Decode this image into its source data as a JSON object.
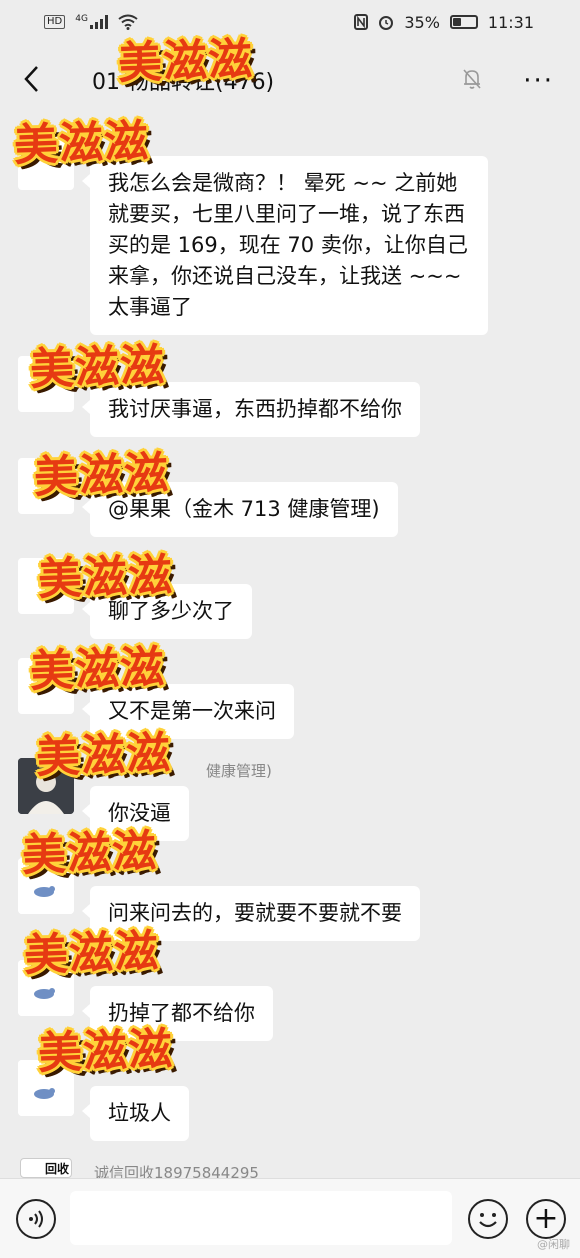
{
  "status_bar": {
    "hd": "HD",
    "network": "4G",
    "battery": "35%",
    "battery_level": 0.35,
    "time": "11:31"
  },
  "header": {
    "title": "01              物品转让(476)",
    "back_icon": "chevron-left-icon",
    "mute_icon": "bell-off-icon",
    "more_icon": "ellipsis-icon",
    "more_label": "···"
  },
  "messages": [
    {
      "text": "我怎么会是微商？！ 晕死 ~~ 之前她就要买，七里八里问了一堆，说了东西买的是 169，现在 70 卖你，让你自己来拿，你还说自己没车，让我送 ~~~ 太事逼了"
    },
    {
      "text": "我讨厌事逼，东西扔掉都不给你"
    },
    {
      "text": "@果果（金木 713 健康管理)"
    },
    {
      "text": "聊了多少次了"
    },
    {
      "text": "又不是第一次来问"
    },
    {
      "sender": "健康管理)",
      "text": "你没逼"
    },
    {
      "text": "问来问去的，要就要不要就不要"
    },
    {
      "text": "扔掉了都不给你"
    },
    {
      "text": "垃圾人"
    },
    {
      "sender": "诚信回收18975844295",
      "avatar_text": "回收"
    }
  ],
  "stickers": [
    "美滋滋",
    "美滋滋",
    "美滋滋",
    "美滋滋",
    "美滋滋",
    "美滋滋",
    "美滋滋",
    "美滋滋",
    "美滋滋",
    "美滋滋"
  ],
  "input_bar": {
    "voice_icon": "voice-icon",
    "emoji_icon": "emoji-icon",
    "plus_icon": "plus-icon",
    "plus_label": "+"
  },
  "corner_mark": "@闲聊"
}
